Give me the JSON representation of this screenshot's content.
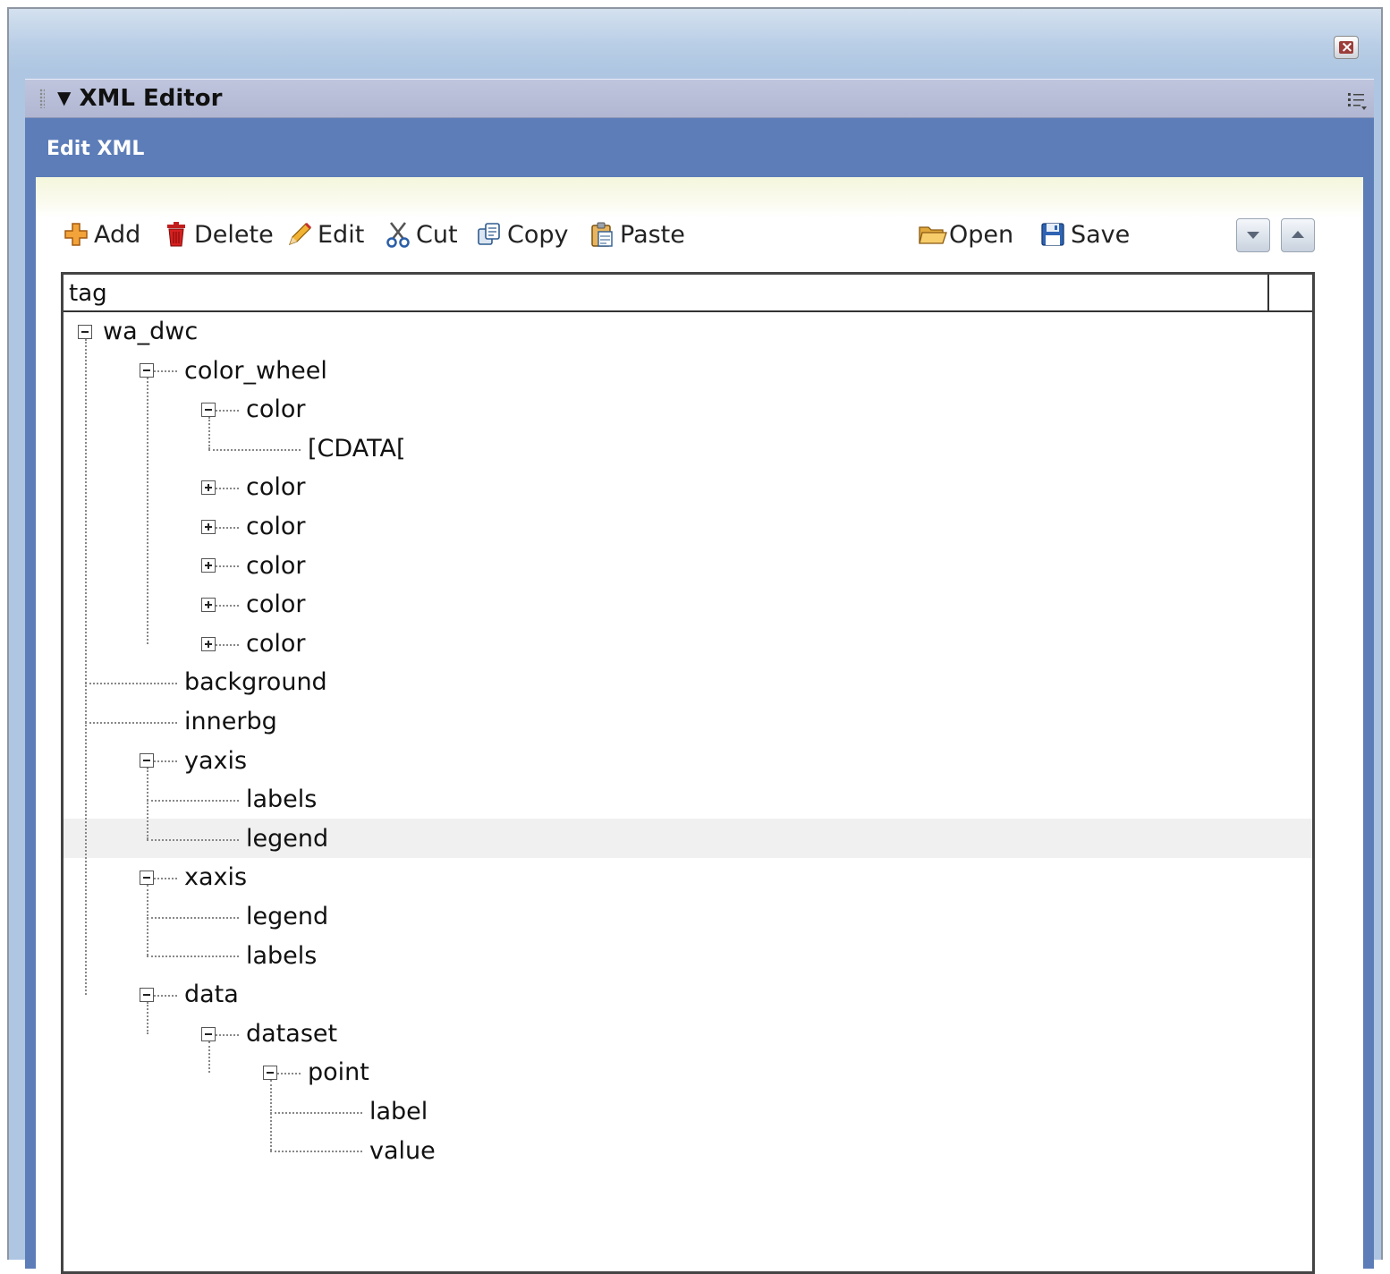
{
  "panel": {
    "title": "XML Editor",
    "collapse_glyph": "▼",
    "options_icon": "list-options-icon",
    "close_glyph": "×"
  },
  "editor": {
    "title": "Edit XML"
  },
  "toolbar": {
    "add_label": "Add",
    "delete_label": "Delete",
    "edit_label": "Edit",
    "cut_label": "Cut",
    "copy_label": "Copy",
    "paste_label": "Paste",
    "open_label": "Open",
    "save_label": "Save"
  },
  "tree": {
    "column_header": "tag",
    "selected_node": "yaxis-legend",
    "nodes": [
      {
        "label": "wa_dwc",
        "depth": 0,
        "toggle": "minus"
      },
      {
        "label": "color_wheel",
        "depth": 1,
        "toggle": "minus"
      },
      {
        "label": "color",
        "depth": 2,
        "toggle": "minus"
      },
      {
        "label": "[CDATA[",
        "depth": 3,
        "toggle": null
      },
      {
        "label": "color",
        "depth": 2,
        "toggle": "plus"
      },
      {
        "label": "color",
        "depth": 2,
        "toggle": "plus"
      },
      {
        "label": "color",
        "depth": 2,
        "toggle": "plus"
      },
      {
        "label": "color",
        "depth": 2,
        "toggle": "plus"
      },
      {
        "label": "color",
        "depth": 2,
        "toggle": "plus"
      },
      {
        "label": "background",
        "depth": 1,
        "toggle": null
      },
      {
        "label": "innerbg",
        "depth": 1,
        "toggle": null
      },
      {
        "label": "yaxis",
        "depth": 1,
        "toggle": "minus"
      },
      {
        "label": "labels",
        "depth": 2,
        "toggle": null
      },
      {
        "label": "legend",
        "depth": 2,
        "toggle": null
      },
      {
        "label": "xaxis",
        "depth": 1,
        "toggle": "minus"
      },
      {
        "label": "legend",
        "depth": 2,
        "toggle": null
      },
      {
        "label": "labels",
        "depth": 2,
        "toggle": null
      },
      {
        "label": "data",
        "depth": 1,
        "toggle": "minus"
      },
      {
        "label": "dataset",
        "depth": 2,
        "toggle": "minus"
      },
      {
        "label": "point",
        "depth": 3,
        "toggle": "minus"
      },
      {
        "label": "label",
        "depth": 4,
        "toggle": null
      },
      {
        "label": "value",
        "depth": 4,
        "toggle": null
      }
    ]
  },
  "colors": {
    "accent_band": "#5c7db8",
    "panel_header": "#b5bbd5",
    "selection": "#f0f0f0"
  }
}
